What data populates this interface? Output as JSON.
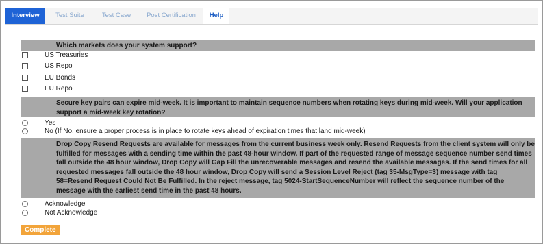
{
  "tabs": [
    {
      "label": "Interview"
    },
    {
      "label": "Test Suite"
    },
    {
      "label": "Test Case"
    },
    {
      "label": "Post Certification"
    },
    {
      "label": "Help"
    }
  ],
  "q1": {
    "text": "Which markets does your system support?",
    "options": [
      "US Treasuries",
      "US Repo",
      "EU Bonds",
      "EU Repo"
    ]
  },
  "q2": {
    "text": "Secure key pairs can expire mid-week. It is important to maintain sequence numbers when rotating keys during mid-week. Will your application support a mid-week key rotation?",
    "options": [
      "Yes",
      "No (If No, ensure a proper process is in place to rotate keys ahead of expiration times that land mid-week)"
    ]
  },
  "q3": {
    "text": "Drop Copy Resend Requests are available for messages from the current business week only. Resend Requests from the client system will only be fulfilled for messages with a sending time within the past 48-hour window. If part of the requested range of message sequence number send times fall outside the 48 hour window, Drop Copy will Gap Fill the unrecoverable messages and resend the available messages. If the send times for all requested messages fall outside the 48 hour window, Drop Copy will send a Session Level Reject (tag 35-MsgType=3) message with tag 58=Resend Request Could Not Be Fulfilled. In the reject message, tag 5024-StartSequenceNumber will reflect the sequence number of the message with the earliest send time in the past 48 hours.",
    "options": [
      "Acknowledge",
      "Not Acknowledge"
    ]
  },
  "complete_label": "Complete",
  "colors": {
    "active_tab": "#1e63d6",
    "question_bar": "#a8a8a8",
    "complete_button": "#f2a43a"
  }
}
